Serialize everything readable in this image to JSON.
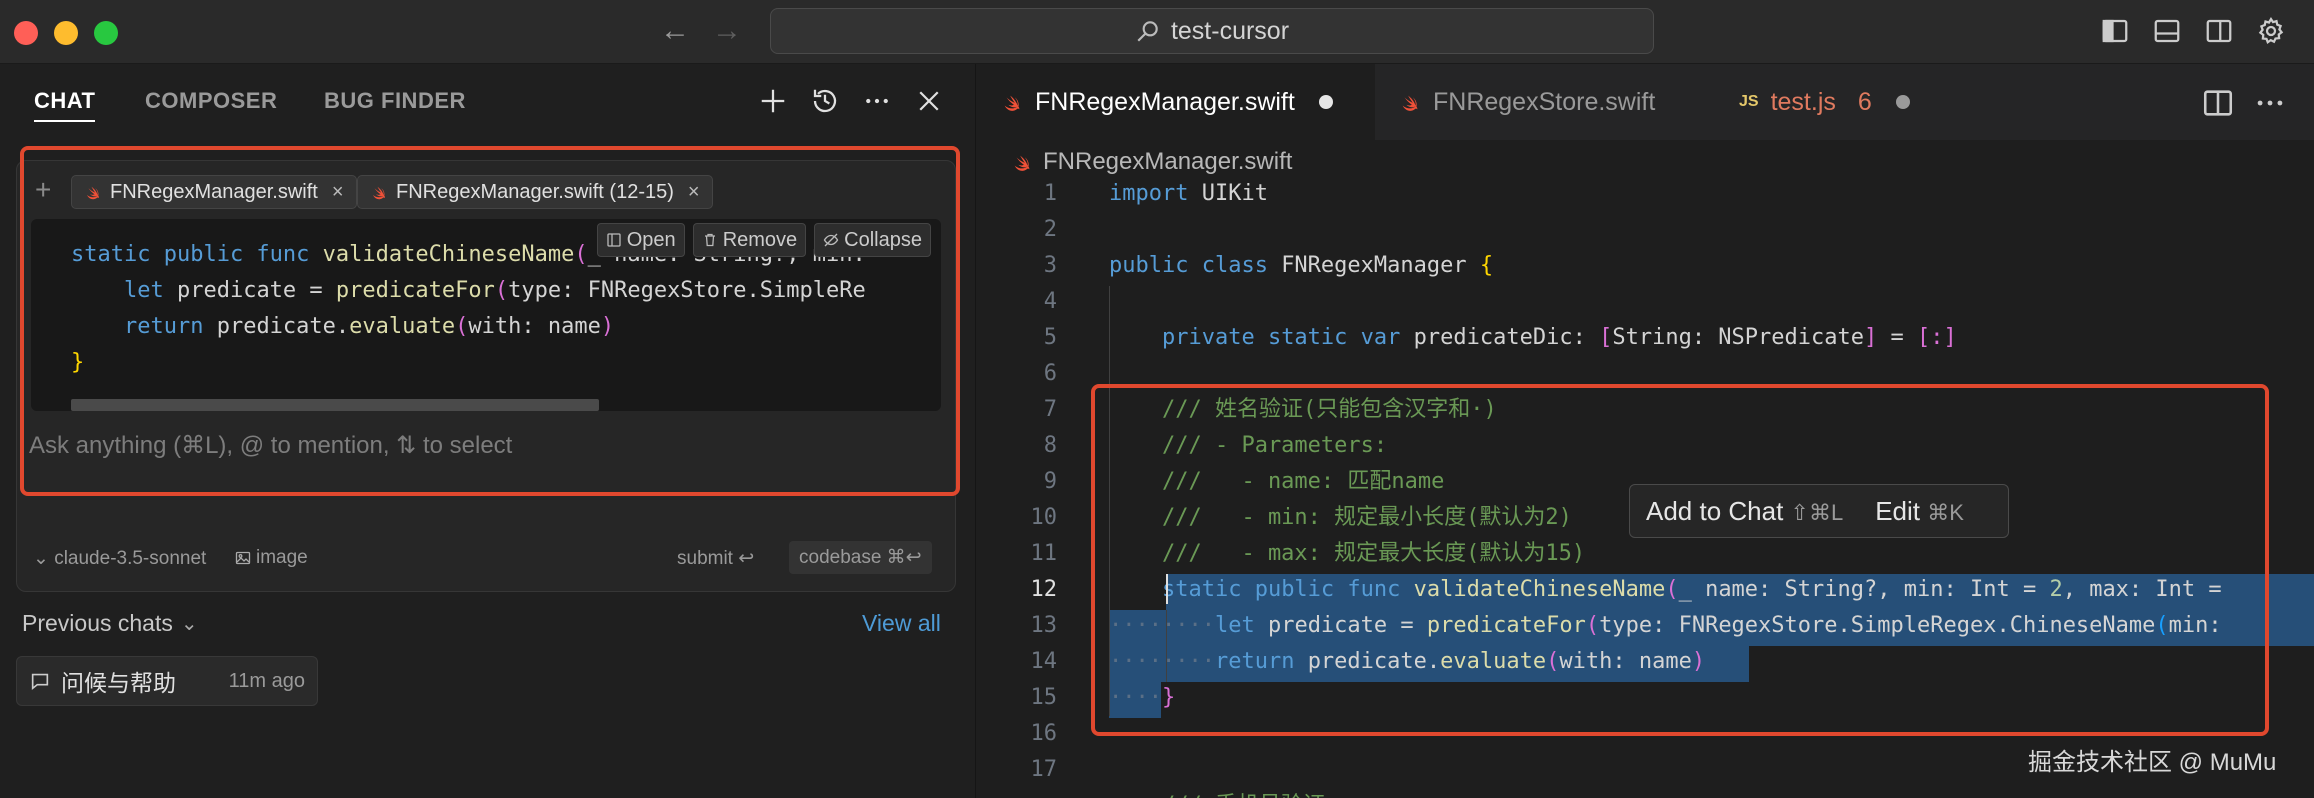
{
  "titlebar": {
    "search_text": "test-cursor"
  },
  "chat": {
    "tabs": [
      "CHAT",
      "COMPOSER",
      "BUG FINDER"
    ],
    "context_chips": [
      {
        "label": "FNRegexManager.swift"
      },
      {
        "label": "FNRegexManager.swift (12-15)"
      }
    ],
    "preview_actions": [
      "Open",
      "Remove",
      "Collapse"
    ],
    "preview_code": [
      "static public func validateChineseName(_ name: String?, min:",
      "    let predicate = predicateFor(type: FNRegexStore.SimpleRe",
      "    return predicate.evaluate(with: name)",
      "}"
    ],
    "input_placeholder": "Ask anything (⌘L), @ to mention, ⇅ to select",
    "model": "claude-3.5-sonnet",
    "image_label": "image",
    "submit_label": "submit ↩",
    "codebase_label": "codebase ⌘↩",
    "previous_chats_label": "Previous chats",
    "view_all_label": "View all",
    "previous_chats": [
      {
        "title": "问候与帮助",
        "time": "11m ago"
      }
    ]
  },
  "editor": {
    "tabs": [
      {
        "label": "FNRegexManager.swift",
        "state": "modified"
      },
      {
        "label": "FNRegexStore.swift"
      },
      {
        "label": "test.js",
        "badge": "JS",
        "errors": "6"
      }
    ],
    "breadcrumb": "FNRegexManager.swift",
    "line_numbers": [
      "1",
      "2",
      "3",
      "4",
      "5",
      "6",
      "7",
      "8",
      "9",
      "10",
      "11",
      "12",
      "13",
      "14",
      "15",
      "16",
      "17"
    ],
    "current_line": "12",
    "popup": {
      "add_label": "Add to Chat",
      "add_kbd": "⇧⌘L",
      "edit_label": "Edit",
      "edit_kbd": "⌘K"
    },
    "watermark": "掘金技术社区 @ MuMu"
  },
  "colors": {
    "accent_red": "#e0482e",
    "selection": "#264f78",
    "link_blue": "#4e9bd6"
  }
}
